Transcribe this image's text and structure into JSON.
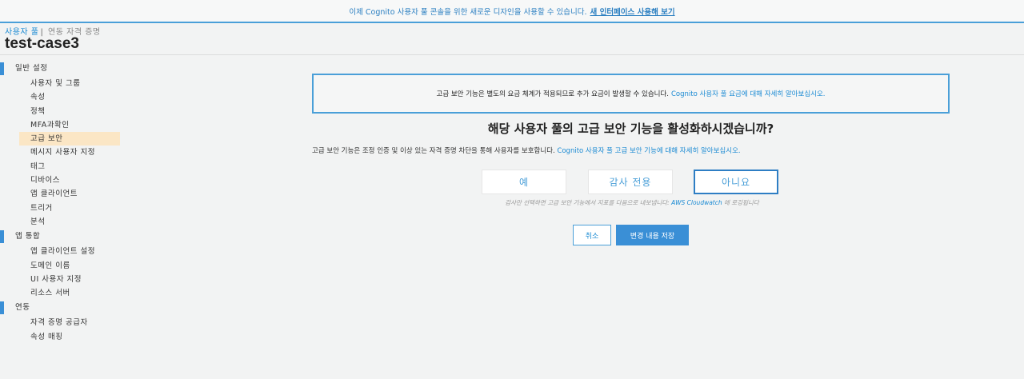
{
  "banner": {
    "text": "이제 Cognito 사용자 풀 콘솔을 위한 새로운 디자인을 사용할 수 있습니다.",
    "link": "새 인터페이스 사용해 보기"
  },
  "breadcrumb": {
    "item1": "사용자 풀",
    "separator": "|",
    "item2": "연동 자격 증명"
  },
  "page_title": "test-case3",
  "sidebar": {
    "sections": [
      {
        "label": "일반 설정",
        "items": [
          "사용자 및 그룹",
          "속성",
          "정책",
          "MFA과확인",
          "고급 보안",
          "메시지 사용자 지정",
          "태그",
          "디바이스",
          "앱 클라이언트",
          "트리거",
          "분석"
        ]
      },
      {
        "label": "앱 통합",
        "items": [
          "앱 클라이언트 설정",
          "도메인 이름",
          "UI 사용자 지정",
          "리소스 서버"
        ]
      },
      {
        "label": "연동",
        "items": [
          "자격 증명 공급자",
          "속성 매핑"
        ]
      }
    ],
    "active_item": "고급 보안"
  },
  "notice": {
    "text": "고급 보안 기능은 별도의 요금 체계가 적용되므로 추가 요금이 발생할 수 있습니다.",
    "link": "Cognito 사용자 풀 요금에 대해 자세히 알아보십시오."
  },
  "question": "해당 사용자 풀의 고급 보안 기능을 활성화하시겠습니까?",
  "description": {
    "text": "고급 보안 기능은 조정 인증 및 이상 있는 자격 증명 차단을 통해 사용자를 보호합니다.",
    "link": "Cognito 사용자 풀 고급 보안 기능에 대해 자세히 알아보십시오."
  },
  "choices": {
    "yes": "예",
    "audit": "감사 전용",
    "no": "아니요",
    "selected": "아니요"
  },
  "hint": {
    "text": "감사만 선택하면 고급 보안 기능에서 지표를 다음으로 내보냅니다:",
    "link": "AWS Cloudwatch",
    "suffix": "에 로깅됩니다"
  },
  "buttons": {
    "cancel": "취소",
    "save": "변경 내용 저장"
  },
  "colors": {
    "accent": "#3a8fd6",
    "active_bg": "#fbe6c5",
    "link": "#1a8ad3"
  }
}
